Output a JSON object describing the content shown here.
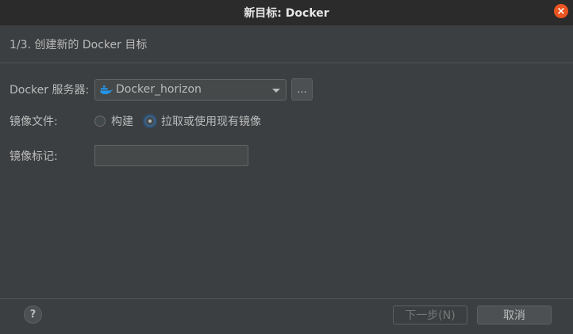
{
  "window": {
    "title": "新目标: Docker",
    "close_glyph": "×"
  },
  "step_header": "1/3. 创建新的 Docker 目标",
  "form": {
    "docker_server": {
      "label": "Docker 服务器:",
      "value": "Docker_horizon",
      "more_label": "..."
    },
    "image_file": {
      "label": "镜像文件:",
      "options": [
        {
          "label": "构建",
          "selected": false
        },
        {
          "label": "拉取或使用现有镜像",
          "selected": true
        }
      ]
    },
    "image_tag": {
      "label": "镜像标记:",
      "value": ""
    }
  },
  "footer": {
    "help_label": "?",
    "next_label": "下一步(N)",
    "cancel_label": "取消"
  },
  "colors": {
    "accent_close": "#e95420",
    "docker_blue": "#2496ed",
    "background": "#3c3f41"
  },
  "icons": {
    "docker_icon": "docker-whale-icon",
    "help_icon": "question-icon",
    "close_icon": "close-icon"
  }
}
